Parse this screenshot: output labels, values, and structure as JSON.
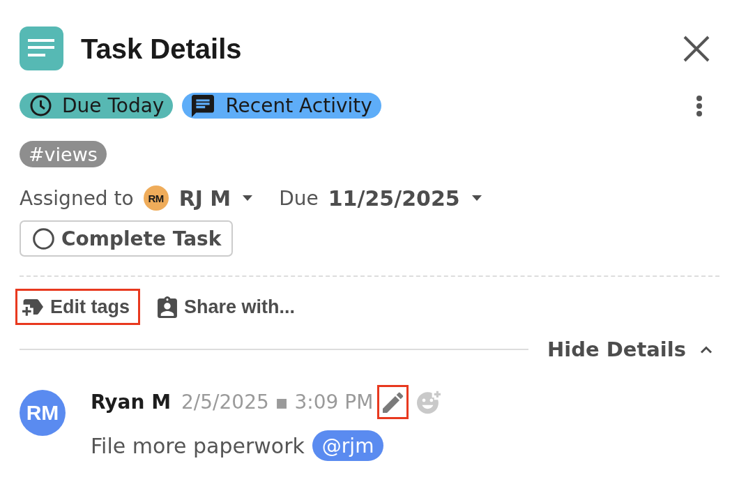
{
  "header": {
    "title": "Task Details"
  },
  "status_badges": [
    {
      "label": "Due Today",
      "kind": "due",
      "color": "#57b8b3"
    },
    {
      "label": "Recent Activity",
      "kind": "activity",
      "color": "#5eadf8"
    }
  ],
  "tags": [
    {
      "label": "#views"
    }
  ],
  "assignment": {
    "label": "Assigned to",
    "assignee_initials": "RM",
    "assignee": "RJ M",
    "due_label": "Due",
    "due_date": "11/25/2025"
  },
  "complete_button": {
    "label": "Complete Task",
    "checked": false
  },
  "actions": [
    {
      "label": "Edit tags",
      "kind": "tag",
      "highlighted": true
    },
    {
      "label": "Share with...",
      "kind": "share",
      "highlighted": false
    }
  ],
  "details_toggle": {
    "label": "Hide Details",
    "expanded": true
  },
  "comments": [
    {
      "initials": "RM",
      "author": "Ryan M",
      "timestamp": "2/5/2025 ▪ 3:09 PM",
      "edit_highlighted": true,
      "body": "File more paperwork",
      "mention": "@rjm"
    }
  ]
}
